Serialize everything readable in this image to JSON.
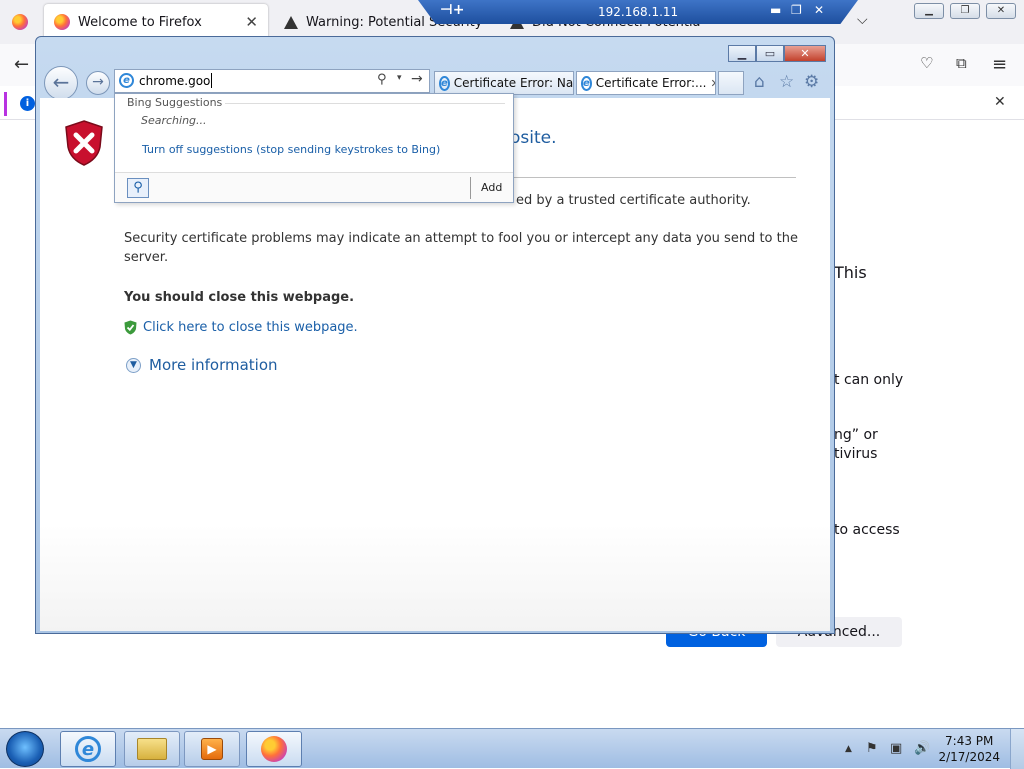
{
  "firefox": {
    "tabs": [
      {
        "label": "Welcome to Firefox"
      },
      {
        "label": "Warning: Potential Security I"
      },
      {
        "label": "Did Not Connect: Potential"
      }
    ],
    "frag_this": "This",
    "frag_canonly": "t can only",
    "frag_ng_or": "ng” or",
    "frag_tivirus": "tivirus",
    "frag_toaccess": "to access",
    "go_back": "Go Back",
    "advanced": "Advanced..."
  },
  "rdp": {
    "title": "192.168.1.11"
  },
  "ie": {
    "address_value": "chrome.goo",
    "tabs": [
      {
        "label": "Certificate Error: Na..."
      },
      {
        "label": "Certificate Error:..."
      }
    ],
    "content": {
      "title_fragment": "osite.",
      "cert_fragment": "ed by a trusted certificate authority.",
      "security_text": "Security certificate problems may indicate an attempt to fool you or intercept any data you send to the server.",
      "close_bold": "You should close this webpage.",
      "close_link": "Click here to close this webpage.",
      "more_info": "More information"
    },
    "suggestions": {
      "heading": "Bing Suggestions",
      "searching": "Searching...",
      "turn_off": "Turn off suggestions (stop sending keystrokes to Bing)",
      "add": "Add"
    }
  },
  "taskbar": {
    "time": "7:43 PM",
    "date": "2/17/2024"
  }
}
